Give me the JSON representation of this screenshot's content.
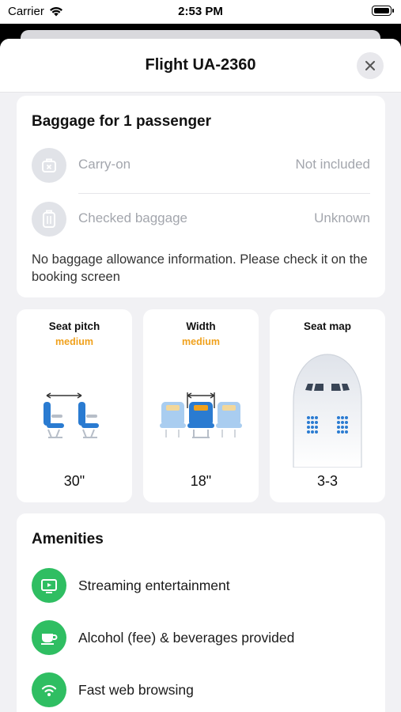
{
  "status_bar": {
    "carrier": "Carrier",
    "time": "2:53 PM"
  },
  "sheet": {
    "title": "Flight UA-2360"
  },
  "baggage": {
    "title": "Baggage for 1 passenger",
    "items": [
      {
        "label": "Carry-on",
        "value": "Not included",
        "icon": "carry-on-bag-icon"
      },
      {
        "label": "Checked baggage",
        "value": "Unknown",
        "icon": "suitcase-icon"
      }
    ],
    "note": "No baggage allowance information. Please check it on the booking screen"
  },
  "seat_info": [
    {
      "title": "Seat pitch",
      "rating": "medium",
      "value": "30\""
    },
    {
      "title": "Width",
      "rating": "medium",
      "value": "18\""
    },
    {
      "title": "Seat map",
      "rating": "",
      "value": "3-3"
    }
  ],
  "amenities": {
    "title": "Amenities",
    "items": [
      {
        "label": "Streaming entertainment",
        "icon": "tv-play-icon"
      },
      {
        "label": "Alcohol (fee) & beverages provided",
        "icon": "cup-icon"
      },
      {
        "label": "Fast web browsing",
        "icon": "wifi-icon"
      }
    ]
  },
  "colors": {
    "accent_orange": "#f0a11c",
    "amenity_green": "#2fbe62",
    "seat_blue": "#2a7bd1",
    "muted_text": "#a3a6ad"
  }
}
